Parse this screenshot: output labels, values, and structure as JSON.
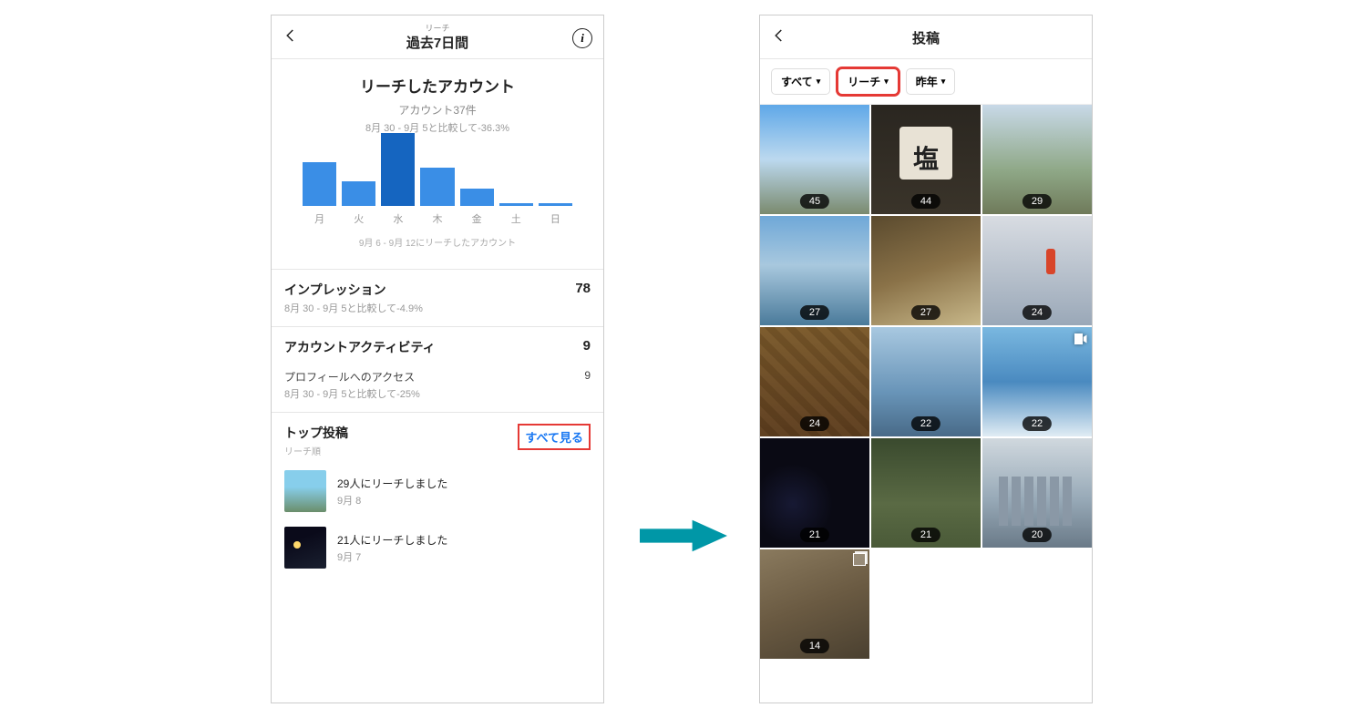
{
  "left": {
    "header": {
      "small": "リーチ",
      "title": "過去7日間"
    },
    "reach": {
      "title": "リーチしたアカウント",
      "accounts": "アカウント37件",
      "compare": "8月 30 -  9月 5と比較して-36.3%"
    },
    "chart_note": "9月 6 -  9月 12にリーチしたアカウント",
    "impressions": {
      "title": "インプレッション",
      "compare": "8月 30 -  9月 5と比較して-4.9%",
      "value": "78"
    },
    "activity": {
      "title": "アカウントアクティビティ",
      "value": "9",
      "profile_label": "プロフィールへのアクセス",
      "profile_value": "9",
      "compare": "8月 30 -  9月 5と比較して-25%"
    },
    "top_posts": {
      "title": "トップ投稿",
      "order": "リーチ順",
      "see_all": "すべて見る",
      "items": [
        {
          "text": "29人にリーチしました",
          "date": "9月 8"
        },
        {
          "text": "21人にリーチしました",
          "date": "9月 7"
        }
      ]
    }
  },
  "right": {
    "header": {
      "title": "投稿"
    },
    "filters": {
      "all": "すべて",
      "reach": "リーチ",
      "year": "昨年"
    },
    "grid": [
      {
        "n": "45"
      },
      {
        "n": "44"
      },
      {
        "n": "29"
      },
      {
        "n": "27"
      },
      {
        "n": "27"
      },
      {
        "n": "24"
      },
      {
        "n": "24"
      },
      {
        "n": "22"
      },
      {
        "n": "22",
        "video": true
      },
      {
        "n": "21"
      },
      {
        "n": "21"
      },
      {
        "n": "20"
      },
      {
        "n": "14",
        "multi": true
      }
    ]
  },
  "chart_data": {
    "type": "bar",
    "categories": [
      "月",
      "火",
      "水",
      "木",
      "金",
      "土",
      "日"
    ],
    "values": [
      46,
      26,
      76,
      40,
      18,
      3,
      3
    ],
    "title": "リーチしたアカウント",
    "xlabel": "",
    "ylabel": "",
    "peak_index": 2
  }
}
